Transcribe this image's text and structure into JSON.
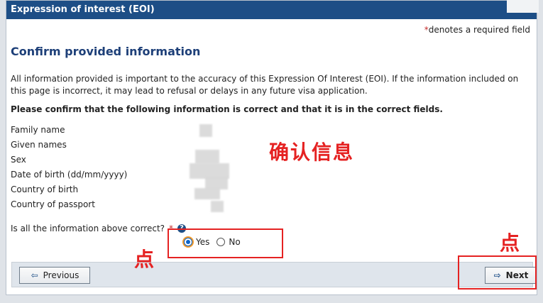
{
  "window": {
    "title": "Expression of interest (EOI)"
  },
  "header": {
    "required_note_star": "*",
    "required_note_text": "denotes a required field"
  },
  "page": {
    "title": "Confirm provided information",
    "intro": "All information provided is important to the accuracy of this Expression Of Interest (EOI). If the information included on this page is incorrect, it may lead to refusal or delays in any future visa application.",
    "confirm_heading": "Please confirm that the following information is correct and that it is in the correct fields."
  },
  "fields": [
    {
      "label": "Family name"
    },
    {
      "label": "Given names"
    },
    {
      "label": "Sex"
    },
    {
      "label": "Date of birth (dd/mm/yyyy)"
    },
    {
      "label": "Country of birth"
    },
    {
      "label": "Country of passport"
    }
  ],
  "question": {
    "text": "Is all the information above correct?",
    "required_star": "*",
    "help_icon": "?"
  },
  "radios": {
    "yes": "Yes",
    "no": "No",
    "selected": "Yes"
  },
  "navigation": {
    "previous_label": "Previous",
    "next_label": "Next"
  },
  "annotations": {
    "main_note": "确认信息",
    "click_left": "点",
    "click_right": "点"
  },
  "colors": {
    "brand_blue": "#1d4e86",
    "annotation_red": "#e52222"
  }
}
